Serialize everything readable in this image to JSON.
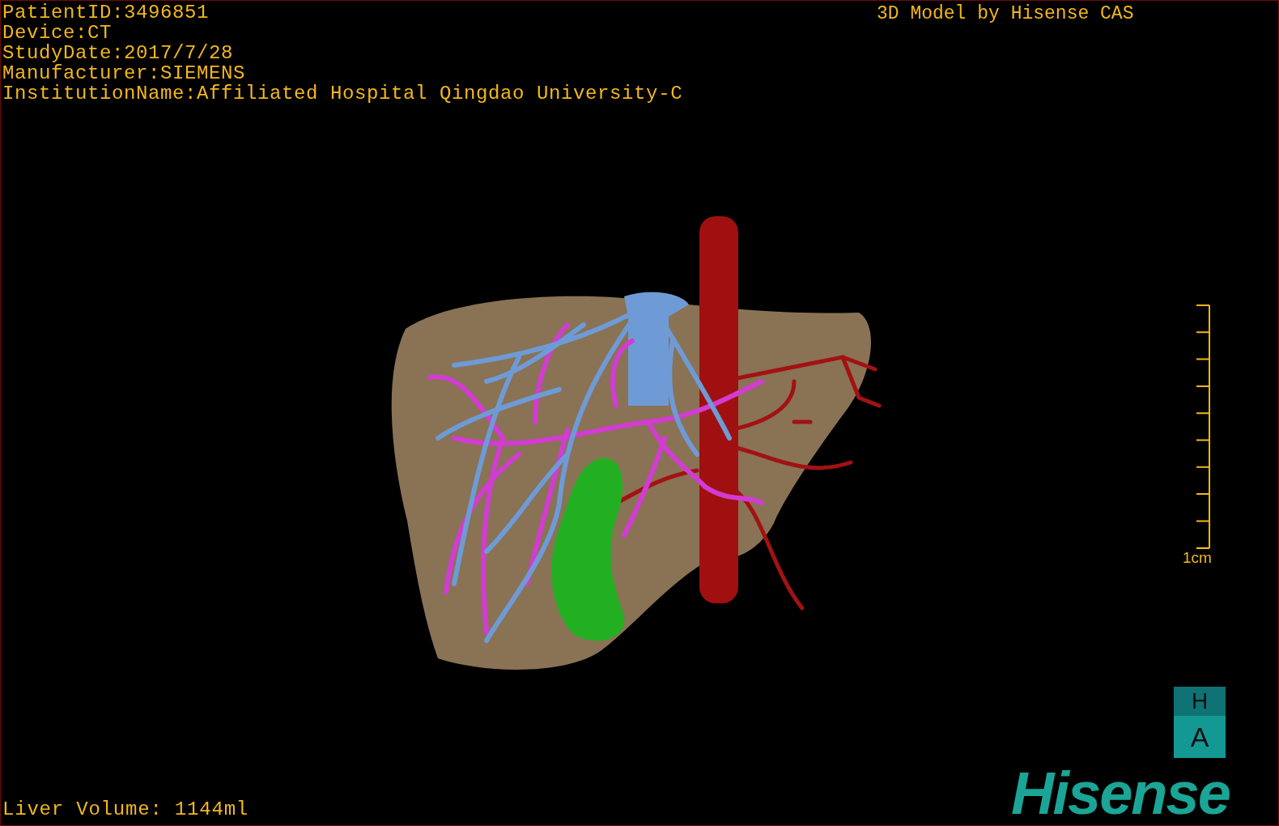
{
  "header_info": [
    "PatientID:3496851",
    "Device:CT",
    "StudyDate:2017/7/28",
    "Manufacturer:SIEMENS",
    "InstitutionName:Affiliated Hospital Qingdao University-C"
  ],
  "model_credit": "3D Model by Hisense CAS",
  "scale_bar": {
    "label": "1cm"
  },
  "orientation_cube": {
    "top_label": "H",
    "front_label": "A"
  },
  "volume_readout": "Liver Volume: 1144ml",
  "logo": {
    "text": "Hisense"
  }
}
